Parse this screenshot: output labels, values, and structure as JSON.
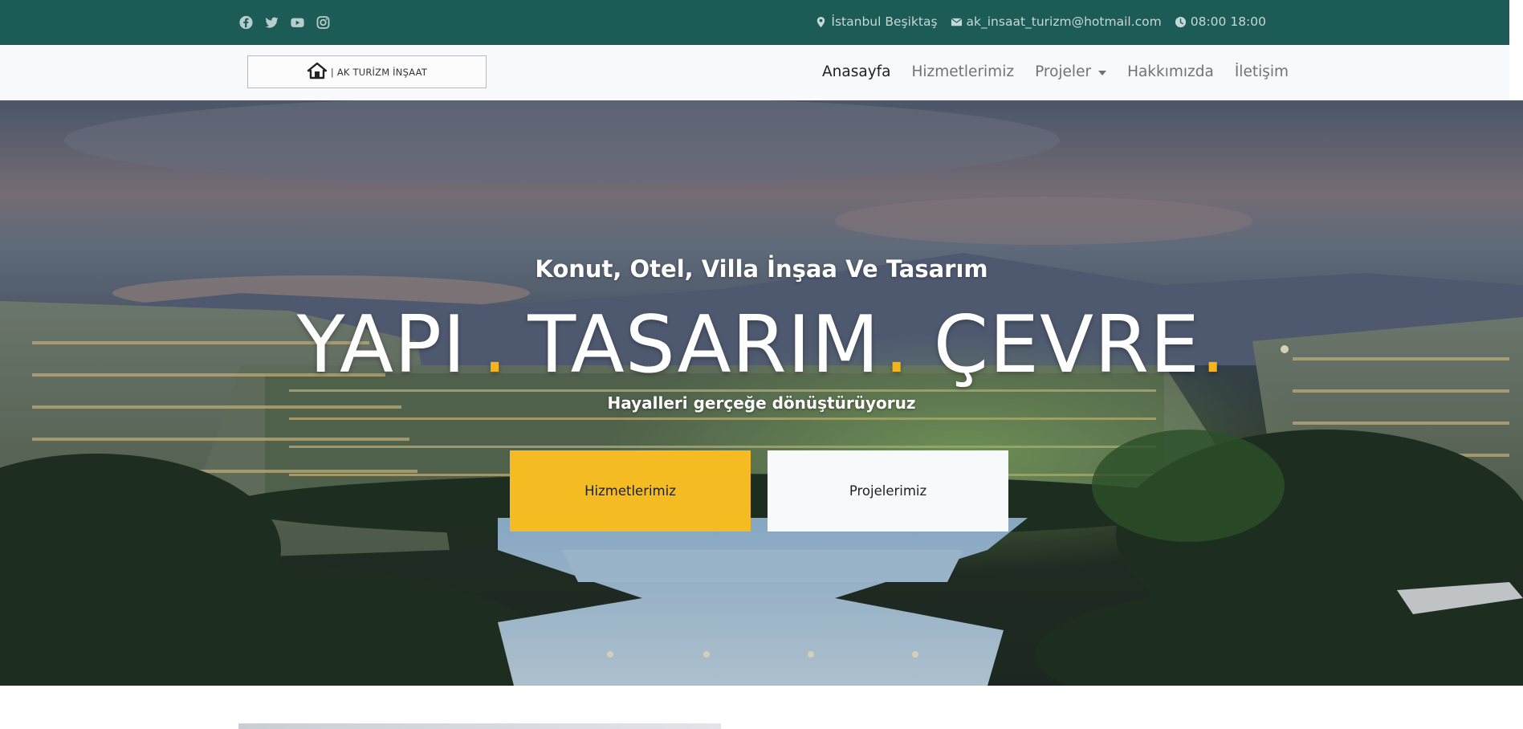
{
  "colors": {
    "topbar": "#1c5b56",
    "accent_yellow": "#f5bb22",
    "nav_bg": "#f8f9fa"
  },
  "topbar": {
    "social_icons": [
      "facebook-icon",
      "twitter-icon",
      "youtube-icon",
      "instagram-icon"
    ],
    "location": "İstanbul Beşiktaş",
    "email": "ak_insaat_turizm@hotmail.com",
    "hours": "08:00 18:00"
  },
  "navbar": {
    "logo_text": "| AK TURİZM İNŞAAT",
    "links": [
      {
        "label": "Anasayfa",
        "active": true
      },
      {
        "label": "Hizmetlerimiz"
      },
      {
        "label": "Projeler",
        "dropdown": true
      },
      {
        "label": "Hakkımızda"
      },
      {
        "label": "İletişim"
      }
    ]
  },
  "hero": {
    "subtitle": "Konut, Otel, Villa İnşaa Ve Tasarım",
    "title_words": [
      "YAPI",
      "TASARIM",
      "ÇEVRE"
    ],
    "title_dot": ".",
    "tagline": "Hayalleri gerçeğe dönüştürüyoruz",
    "buttons": {
      "services": "Hizmetlerimiz",
      "projects": "Projelerimiz"
    }
  }
}
